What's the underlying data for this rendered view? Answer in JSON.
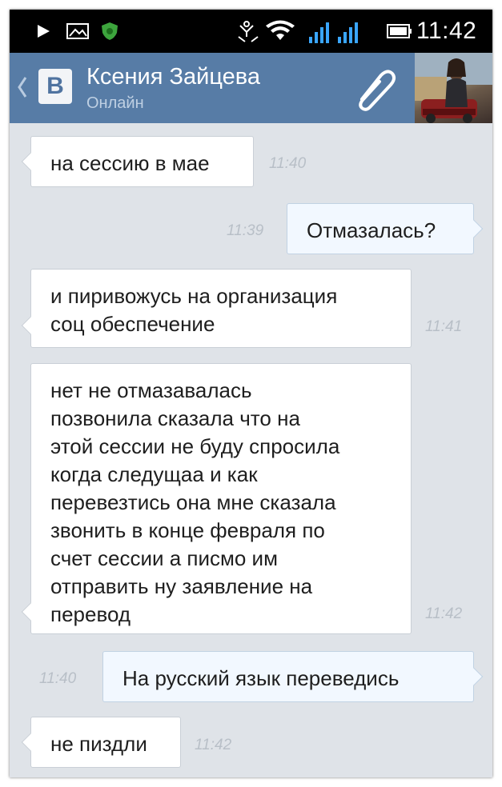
{
  "status_bar": {
    "time": "11:42",
    "icons": [
      "play-icon",
      "picture-icon",
      "shield-icon",
      "sync-icon",
      "wifi-icon",
      "signal-icon",
      "signal-icon",
      "battery-icon"
    ]
  },
  "header": {
    "logo": "В",
    "contact_name": "Ксения Зайцева",
    "contact_status": "Онлайн",
    "attach_icon": "paperclip-icon"
  },
  "messages": [
    {
      "direction": "incoming",
      "text": "на сессию в мае",
      "time": "11:40"
    },
    {
      "direction": "outgoing",
      "text": "Отмазалась?",
      "time": "11:39"
    },
    {
      "direction": "incoming",
      "text": "и пиривожусь на организация\nсоц обеспечение",
      "time": "11:41"
    },
    {
      "direction": "incoming",
      "text": "нет не отмазавалась\nпозвонила сказала что на\nэтой сессии не буду спросила\nкогда следущаа и как\nперевезтись она мне сказала\nзвонить в конце февраля по\nсчет сессии а писмо им\nотправить ну заявление на\nперевод",
      "time": "11:42"
    },
    {
      "direction": "outgoing",
      "text": "На русский язык переведись",
      "time": "11:40"
    },
    {
      "direction": "incoming",
      "text": "не пиздли",
      "time": "11:42"
    }
  ],
  "colors": {
    "header_bg": "#577ca6",
    "chat_bg": "#dfe3e8",
    "incoming_bubble": "#ffffff",
    "outgoing_bubble": "#f2f8ff",
    "timestamp": "#b8bfc7"
  }
}
